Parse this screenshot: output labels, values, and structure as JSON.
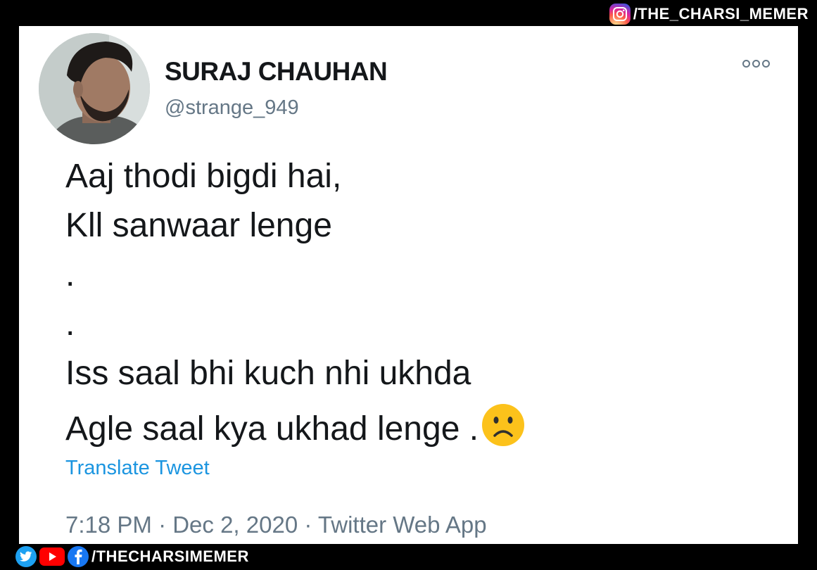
{
  "watermark_top": {
    "text": "/THE_CHARSI_MEMER",
    "icon": "instagram-icon"
  },
  "tweet": {
    "display_name": "SURAJ CHAUHAN",
    "handle": "@strange_949",
    "lines": [
      "Aaj thodi bigdi hai,",
      "Kll sanwaar lenge",
      ".",
      ".",
      "Iss saal bhi kuch nhi ukhda",
      "Agle saal kya ukhad lenge ."
    ],
    "emoji": "frowning-face-emoji",
    "translate_label": "Translate Tweet",
    "meta": "7:18 PM · Dec 2, 2020 · Twitter Web App",
    "more_icon": "more-options-icon"
  },
  "watermark_bottom": {
    "text": "/THECHARSIMEMER",
    "icons": [
      "twitter-icon",
      "youtube-icon",
      "facebook-icon"
    ]
  },
  "colors": {
    "background": "#000000",
    "card": "#ffffff",
    "text": "#14171a",
    "secondary": "#657786",
    "link": "#1b95e0"
  }
}
